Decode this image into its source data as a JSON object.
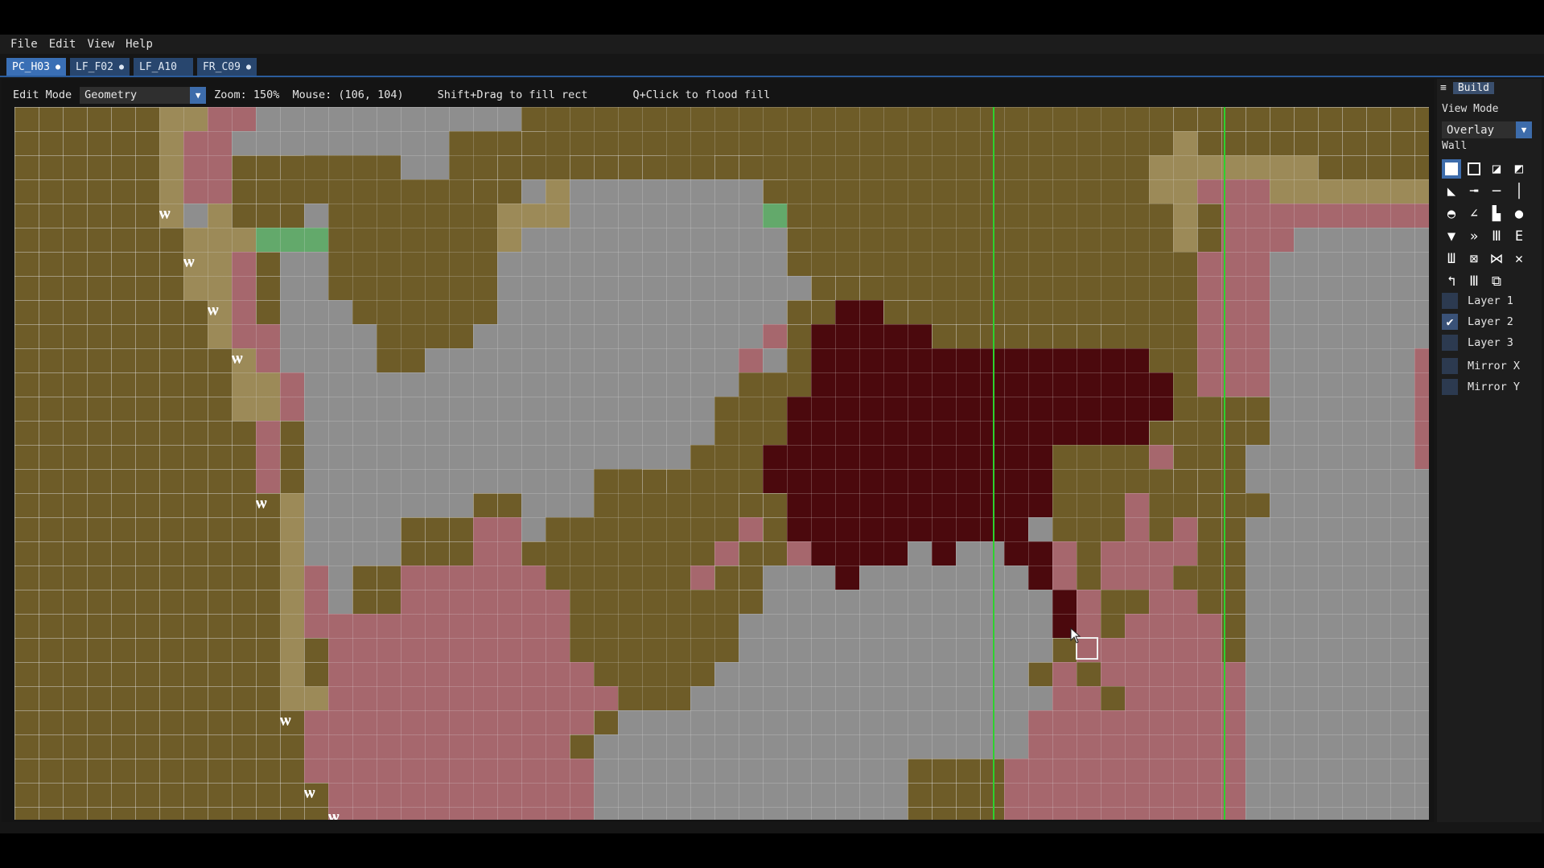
{
  "menu": [
    "File",
    "Edit",
    "View",
    "Help"
  ],
  "tabs": [
    {
      "label": "PC_H03",
      "modified": "●",
      "active": true
    },
    {
      "label": "LF_F02",
      "modified": "●",
      "active": false
    },
    {
      "label": "LF_A10",
      "modified": "",
      "active": false
    },
    {
      "label": "FR_C09",
      "modified": "●",
      "active": false
    }
  ],
  "toolbar": {
    "edit_mode_label": "Edit Mode",
    "edit_mode_value": "Geometry",
    "zoom": "Zoom: 150%",
    "mouse": "Mouse: (106, 104)",
    "hint_rect": "Shift+Drag to fill rect",
    "hint_flood": "Q+Click to flood fill"
  },
  "side_panel": {
    "title": "Build",
    "view_mode_label": "View Mode",
    "view_mode_value": "Overlay",
    "wall_label": "Wall",
    "tool_icons": [
      {
        "name": "solid-square-icon",
        "glyph": "",
        "selected": true
      },
      {
        "name": "outline-square-icon",
        "glyph": "",
        "selected": false
      },
      {
        "name": "stairs-icon",
        "glyph": "◪",
        "selected": false
      },
      {
        "name": "diagonal-slash-icon",
        "glyph": "◩",
        "selected": false
      },
      {
        "name": "ramp-icon",
        "glyph": "◣",
        "selected": false
      },
      {
        "name": "bar-hook-icon",
        "glyph": "╼",
        "selected": false
      },
      {
        "name": "horizontal-line-icon",
        "glyph": "─",
        "selected": false
      },
      {
        "name": "vertical-line-icon",
        "glyph": "│",
        "selected": false
      },
      {
        "name": "mound-icon",
        "glyph": "◓",
        "selected": false
      },
      {
        "name": "angle-icon",
        "glyph": "∠",
        "selected": false
      },
      {
        "name": "split-square-icon",
        "glyph": "▙",
        "selected": false
      },
      {
        "name": "drop-icon",
        "glyph": "●",
        "selected": false
      },
      {
        "name": "down-triangle-icon",
        "glyph": "▼",
        "selected": false
      },
      {
        "name": "arrows-right-icon",
        "glyph": "»",
        "selected": false
      },
      {
        "name": "columns-icon",
        "glyph": "Ⅲ",
        "selected": false
      },
      {
        "name": "e-bars-icon",
        "glyph": "Ε",
        "selected": false
      },
      {
        "name": "pillars-icon",
        "glyph": "Ш",
        "selected": false
      },
      {
        "name": "frame-x-icon",
        "glyph": "⊠",
        "selected": false
      },
      {
        "name": "bowtie-icon",
        "glyph": "⋈",
        "selected": false
      },
      {
        "name": "cross-icon",
        "glyph": "✕",
        "selected": false
      },
      {
        "name": "curve-icon",
        "glyph": "↰",
        "selected": false
      },
      {
        "name": "gate-icon",
        "glyph": "Ⅲ",
        "selected": false
      },
      {
        "name": "stacked-square-icon",
        "glyph": "⧉",
        "selected": false
      }
    ],
    "layers": [
      {
        "label": "Layer 1",
        "checked": false
      },
      {
        "label": "Layer 2",
        "checked": true
      },
      {
        "label": "Layer 3",
        "checked": false
      }
    ],
    "mirror_x": "Mirror X",
    "mirror_y": "Mirror Y",
    "check_glyph": "✔"
  },
  "colors": {
    "ground": "#6e5c28",
    "tan": "#9c8a58",
    "floor_gray": "#8e8e8e",
    "pink": "#a6676d",
    "dark_red": "#4b090d",
    "highlight_green": "#63a96b",
    "guide_green": "#2ed12e",
    "accent_blue": "#3d6cab"
  },
  "tuft_glyph": "ѡ"
}
